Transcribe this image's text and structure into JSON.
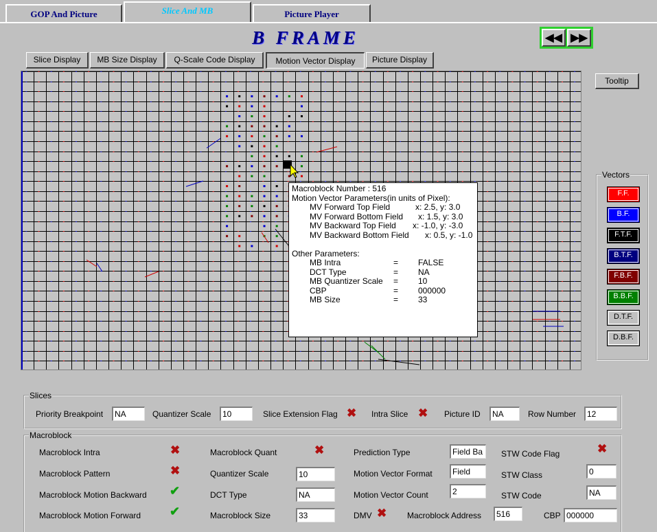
{
  "top_tabs": [
    "GOP  And  Picture",
    "Slice  And  MB",
    "Picture  Player"
  ],
  "frame_title": "B FRAME",
  "nav": {
    "rewind": "◀◀",
    "forward": "▶▶"
  },
  "sub_tabs": [
    "Slice Display",
    "MB Size Display",
    "Q-Scale Code Display",
    "Motion Vector Display",
    "Picture Display"
  ],
  "tooltip_button": "Tooltip",
  "vectors": {
    "legend": "Vectors",
    "items": [
      {
        "label": "F.F.",
        "bg": "#ff0000",
        "fg": "#ffffff"
      },
      {
        "label": "B.F.",
        "bg": "#0000ff",
        "fg": "#ffffff"
      },
      {
        "label": "F.T.F.",
        "bg": "#000000",
        "fg": "#ffffff"
      },
      {
        "label": "B.T.F.",
        "bg": "#000080",
        "fg": "#ffffff"
      },
      {
        "label": "F.B.F.",
        "bg": "#800000",
        "fg": "#ffffff"
      },
      {
        "label": "B.B.F.",
        "bg": "#008000",
        "fg": "#ffffff"
      },
      {
        "label": "D.T.F.",
        "bg": "#c0c0c0",
        "fg": "#000000"
      },
      {
        "label": "D.B.F.",
        "bg": "#c0c0c0",
        "fg": "#000000"
      }
    ]
  },
  "popup": {
    "line1": "Macroblock Number : 516",
    "line2": "Motion Vector Parameters(in units of Pixel):",
    "mv": [
      {
        "name": "MV Forward Top Field",
        "val": "x: 2.5, y: 3.0"
      },
      {
        "name": "MV Forward Bottom Field",
        "val": "x: 1.5, y: 3.0"
      },
      {
        "name": "MV Backward Top Field",
        "val": "x: -1.0, y: -3.0"
      },
      {
        "name": "MV Backward Bottom Field",
        "val": "x: 0.5, y: -1.0"
      }
    ],
    "other_header": "Other Parameters:",
    "other": [
      {
        "name": "MB Intra",
        "eq": "=",
        "val": "FALSE"
      },
      {
        "name": "DCT Type",
        "eq": "=",
        "val": "NA"
      },
      {
        "name": "MB Quantizer Scale",
        "eq": "=",
        "val": "10"
      },
      {
        "name": "CBP",
        "eq": "=",
        "val": "000000"
      },
      {
        "name": "MB Size",
        "eq": "=",
        "val": "33"
      }
    ]
  },
  "slices": {
    "legend": "Slices",
    "priority_breakpoint_label": "Priority Breakpoint",
    "priority_breakpoint": "NA",
    "quantizer_scale_label": "Quantizer Scale",
    "quantizer_scale": "10",
    "slice_extension_flag_label": "Slice Extension Flag",
    "intra_slice_label": "Intra Slice",
    "picture_id_label": "Picture ID",
    "picture_id": "NA",
    "row_number_label": "Row Number",
    "row_number": "12"
  },
  "macroblock": {
    "legend": "Macroblock",
    "intra_label": "Macroblock Intra",
    "pattern_label": "Macroblock Pattern",
    "motion_backward_label": "Macroblock Motion Backward",
    "motion_forward_label": "Macroblock Motion Forward",
    "quant_label": "Macroblock Quant",
    "quantizer_scale_label": "Quantizer Scale",
    "quantizer_scale": "10",
    "dct_type_label": "DCT Type",
    "dct_type": "NA",
    "size_label": "Macroblock Size",
    "size": "33",
    "prediction_type_label": "Prediction Type",
    "prediction_type": "Field Ba",
    "mv_format_label": "Motion Vector Format",
    "mv_format": "Field",
    "mv_count_label": "Motion Vector Count",
    "mv_count": "2",
    "dmv_label": "DMV",
    "address_label": "Macroblock Address",
    "address": "516",
    "stw_code_flag_label": "STW Code Flag",
    "stw_class_label": "STW Class",
    "stw_class": "0",
    "stw_code_label": "STW Code",
    "stw_code": "NA",
    "cbp_label": "CBP",
    "cbp": "000000"
  }
}
